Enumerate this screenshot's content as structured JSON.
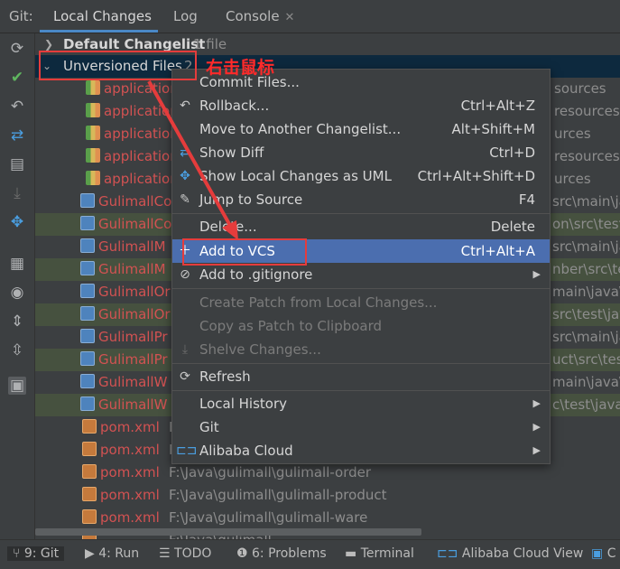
{
  "topbar": {
    "git_label": "Git:",
    "tabs": [
      {
        "label": "Local Changes"
      },
      {
        "label": "Log"
      },
      {
        "label": "Console"
      }
    ]
  },
  "tree": {
    "default_changelist": {
      "label": "Default Changelist",
      "count": "1 file"
    },
    "unversioned": {
      "label": "Unversioned Files",
      "count": "2"
    },
    "rows": [
      {
        "name": "application",
        "path": "sources"
      },
      {
        "name": "application",
        "path": "resources"
      },
      {
        "name": "application",
        "path": "urces"
      },
      {
        "name": "application",
        "path": "resources"
      },
      {
        "name": "application",
        "path": "urces"
      },
      {
        "name": "GulimallCo",
        "path": "src\\main\\java"
      },
      {
        "name": "GulimallCo",
        "path": "on\\src\\test\\"
      },
      {
        "name": "GulimallM",
        "path": "src\\main\\jav"
      },
      {
        "name": "GulimallM",
        "path": "nber\\src\\te"
      },
      {
        "name": "GulimallOr",
        "path": "main\\java\\co"
      },
      {
        "name": "GulimallOr",
        "path": "src\\test\\jav"
      },
      {
        "name": "GulimallPr",
        "path": "src\\main\\jav"
      },
      {
        "name": "GulimallPr",
        "path": "uct\\src\\test"
      },
      {
        "name": "GulimallW",
        "path": "main\\java\\com"
      },
      {
        "name": "GulimallW",
        "path": "c\\test\\java\\"
      },
      {
        "name": "pom.xml",
        "path": "F"
      },
      {
        "name": "pom.xml",
        "path": "F"
      },
      {
        "name": "pom.xml",
        "path": "F:\\Java\\gulimall\\gulimall-order"
      },
      {
        "name": "pom.xml",
        "path": "F:\\Java\\gulimall\\gulimall-product"
      },
      {
        "name": "pom.xml",
        "path": "F:\\Java\\gulimall\\gulimall-ware"
      },
      {
        "name": "",
        "path": "F:\\Java\\gulimall"
      }
    ]
  },
  "context_menu": {
    "items": [
      {
        "label": "Commit Files...",
        "shortcut": ""
      },
      {
        "label": "Rollback...",
        "shortcut": "Ctrl+Alt+Z"
      },
      {
        "label": "Move to Another Changelist...",
        "shortcut": "Alt+Shift+M"
      },
      {
        "label": "Show Diff",
        "shortcut": "Ctrl+D"
      },
      {
        "label": "Show Local Changes as UML",
        "shortcut": "Ctrl+Alt+Shift+D"
      },
      {
        "label": "Jump to Source",
        "shortcut": "F4"
      },
      {
        "label": "Delete...",
        "shortcut": "Delete"
      },
      {
        "label": "Add to VCS",
        "shortcut": "Ctrl+Alt+A"
      },
      {
        "label": "Add to .gitignore",
        "shortcut": ""
      },
      {
        "label": "Create Patch from Local Changes...",
        "shortcut": ""
      },
      {
        "label": "Copy as Patch to Clipboard",
        "shortcut": ""
      },
      {
        "label": "Shelve Changes...",
        "shortcut": ""
      },
      {
        "label": "Refresh",
        "shortcut": ""
      },
      {
        "label": "Local History",
        "shortcut": ""
      },
      {
        "label": "Git",
        "shortcut": ""
      },
      {
        "label": "Alibaba Cloud",
        "shortcut": ""
      }
    ]
  },
  "annotation": {
    "text": "右击鼠标"
  },
  "statusbar": {
    "items": [
      {
        "label": "9: Git"
      },
      {
        "label": "4: Run"
      },
      {
        "label": "TODO"
      },
      {
        "label": "6: Problems"
      },
      {
        "label": "Terminal"
      },
      {
        "label": "Alibaba Cloud View"
      },
      {
        "label": "C"
      }
    ]
  },
  "colors": {
    "selection": "#0d293e",
    "menu_highlight": "#4b6eaf",
    "annotation_red": "#e53c3c",
    "unversioned_file": "#d25252"
  }
}
